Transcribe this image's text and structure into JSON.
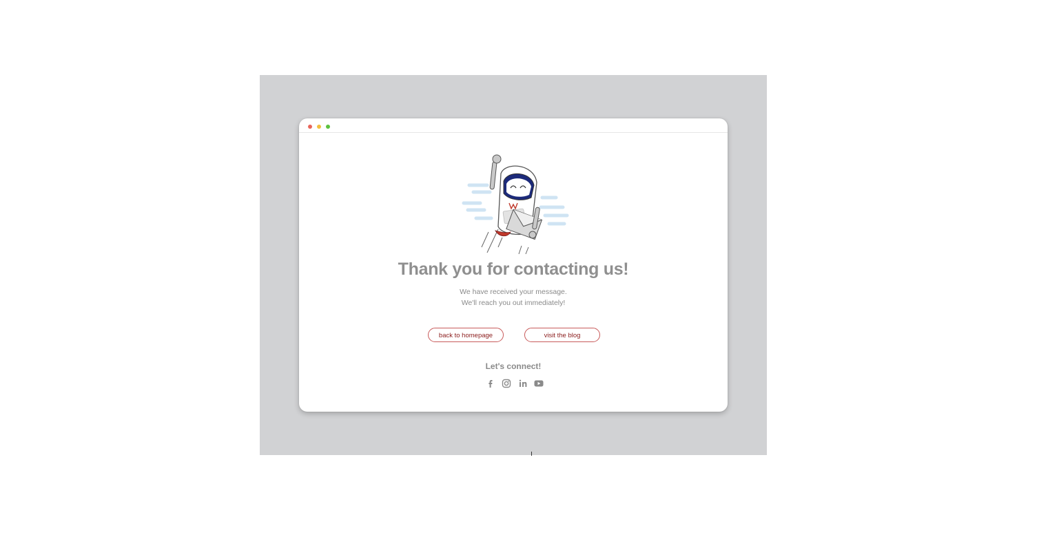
{
  "page": {
    "title": "Thank you for contacting us!",
    "message_line1": "We have received your message.",
    "message_line2": "We'll reach you out immediately!"
  },
  "buttons": {
    "home_label": "back to homepage",
    "blog_label": "visit the blog"
  },
  "connect": {
    "label": "Let's connect!",
    "icons": [
      "facebook-icon",
      "instagram-icon",
      "linkedin-icon",
      "youtube-icon"
    ]
  },
  "window": {
    "traffic_lights": [
      "#e9665a",
      "#f3bf3f",
      "#5cc23f"
    ]
  },
  "colors": {
    "accent": "#8b1c1c",
    "button_border": "#c85a5a",
    "text_gray": "#8f8f8f",
    "backdrop": "#d1d2d4"
  }
}
